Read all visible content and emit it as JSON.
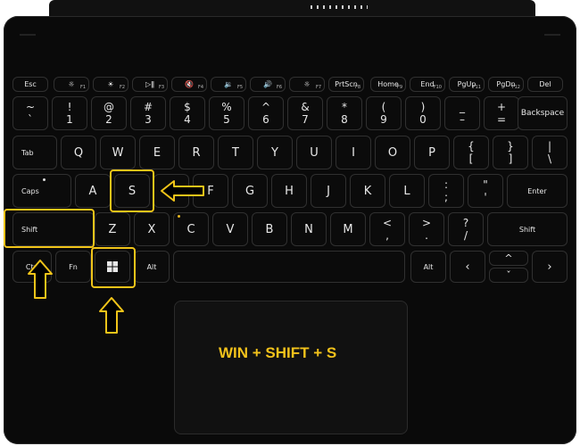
{
  "keyboard": {
    "fn_row": [
      {
        "id": "esc",
        "label": "Esc"
      },
      {
        "id": "f1",
        "icon": "brightness-down-icon",
        "glyph": "☼",
        "fn": "F1"
      },
      {
        "id": "f2",
        "icon": "brightness-up-icon",
        "glyph": "☀",
        "fn": "F2"
      },
      {
        "id": "f3",
        "icon": "play-pause-icon",
        "glyph": "▷ǁ",
        "fn": "F3"
      },
      {
        "id": "f4",
        "icon": "mute-icon",
        "glyph": "🔇",
        "fn": "F4"
      },
      {
        "id": "f5",
        "icon": "volume-down-icon",
        "glyph": "🔉",
        "fn": "F5"
      },
      {
        "id": "f6",
        "icon": "volume-up-icon",
        "glyph": "🔊",
        "fn": "F6"
      },
      {
        "id": "f7",
        "icon": "backlight-icon",
        "glyph": "☼",
        "fn": "F7"
      },
      {
        "id": "prtscn",
        "label": "PrtScn",
        "fn": "F8"
      },
      {
        "id": "home",
        "label": "Home",
        "fn": "F9"
      },
      {
        "id": "end",
        "label": "End",
        "fn": "F10"
      },
      {
        "id": "pgup",
        "label": "PgUp",
        "fn": "F11"
      },
      {
        "id": "pgdn",
        "label": "PgDn",
        "fn": "F12"
      },
      {
        "id": "del",
        "label": "Del"
      }
    ],
    "number_row": [
      {
        "top": "~",
        "bottom": "`"
      },
      {
        "top": "!",
        "bottom": "1"
      },
      {
        "top": "@",
        "bottom": "2"
      },
      {
        "top": "#",
        "bottom": "3"
      },
      {
        "top": "$",
        "bottom": "4"
      },
      {
        "top": "%",
        "bottom": "5"
      },
      {
        "top": "^",
        "bottom": "6"
      },
      {
        "top": "&",
        "bottom": "7"
      },
      {
        "top": "*",
        "bottom": "8"
      },
      {
        "top": "(",
        "bottom": "9"
      },
      {
        "top": ")",
        "bottom": "0"
      },
      {
        "top": "_",
        "bottom": "–"
      },
      {
        "top": "+",
        "bottom": "="
      }
    ],
    "backspace": "Backspace",
    "tab": "Tab",
    "qwerty": [
      "Q",
      "W",
      "E",
      "R",
      "T",
      "Y",
      "U",
      "I",
      "O",
      "P"
    ],
    "brackets": [
      {
        "top": "{",
        "bottom": "["
      },
      {
        "top": "}",
        "bottom": "]"
      },
      {
        "top": "|",
        "bottom": "\\"
      }
    ],
    "caps": "Caps",
    "asdf": [
      "A",
      "S",
      "D",
      "F",
      "G",
      "H",
      "J",
      "K",
      "L"
    ],
    "semicolon": {
      "top": ":",
      "bottom": ";"
    },
    "quote": {
      "top": "\"",
      "bottom": "'"
    },
    "enter": "Enter",
    "shift_left": "Shift",
    "zxcv": [
      "Z",
      "X",
      "C",
      "V",
      "B",
      "N",
      "M"
    ],
    "comma": {
      "top": "<",
      "bottom": ","
    },
    "period": {
      "top": ">",
      "bottom": "."
    },
    "slash": {
      "top": "?",
      "bottom": "/"
    },
    "shift_right": "Shift",
    "ctrl": "Ctrl",
    "fn": "Fn",
    "alt_left": "Alt",
    "alt_right": "Alt",
    "arrows": {
      "left": "‹",
      "up": "^",
      "down": "ˇ",
      "right": "›"
    }
  },
  "caption": "WIN + SHIFT + S",
  "colors": {
    "highlight": "#f0c419",
    "caption": "#f3c21b",
    "key": "#0b0b0b",
    "body": "#0a0a0a"
  }
}
